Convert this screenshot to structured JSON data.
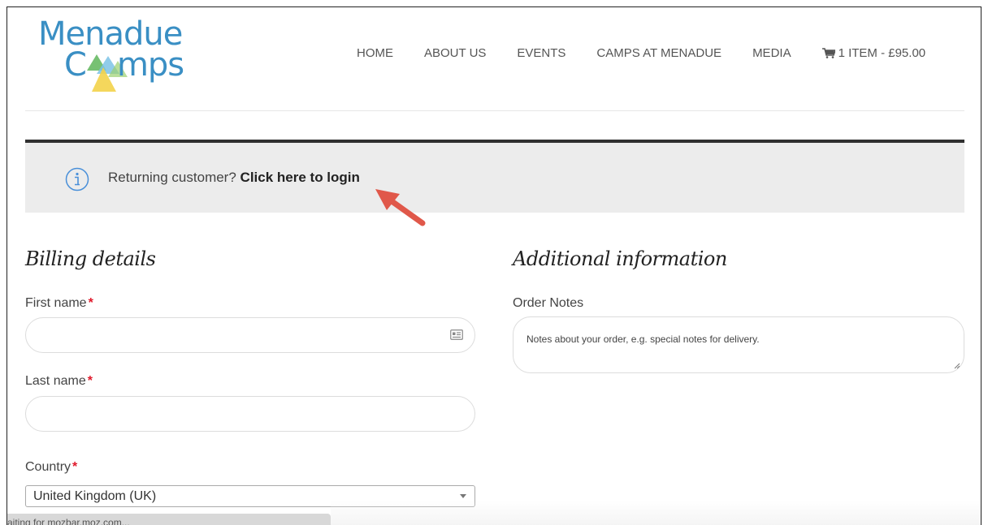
{
  "logo": {
    "line1": "Menadue",
    "line2": "Camps"
  },
  "nav": {
    "items": [
      "HOME",
      "ABOUT US",
      "EVENTS",
      "CAMPS AT MENADUE",
      "MEDIA"
    ],
    "cart_label": "1 ITEM - £95.00"
  },
  "notice": {
    "prefix": "Returning customer?",
    "link": "Click here to login"
  },
  "billing": {
    "title": "Billing details",
    "first_name_label": "First name",
    "last_name_label": "Last name",
    "country_label": "Country",
    "country_value": "United Kingdom (UK)",
    "required_mark": "*"
  },
  "additional": {
    "title": "Additional information",
    "notes_label": "Order Notes",
    "notes_placeholder": "Notes about your order, e.g. special notes for delivery."
  },
  "status": {
    "text": "aiting for mozbar.moz.com..."
  },
  "colors": {
    "brand_blue": "#3a8fc4",
    "required_red": "#e0192b",
    "arrow": "#e0584a"
  }
}
